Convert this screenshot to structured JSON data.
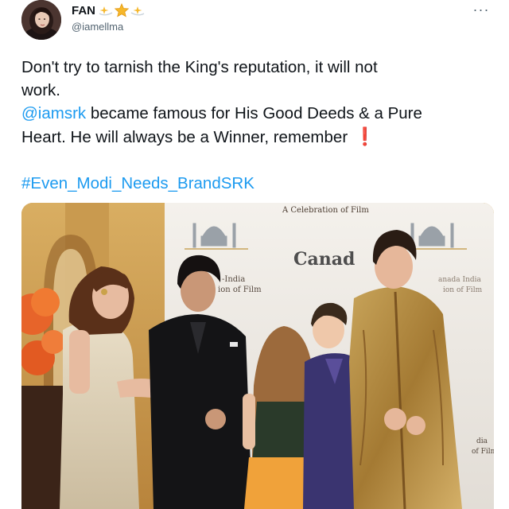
{
  "author": {
    "display_name": "FAN",
    "handle": "@iamellma",
    "name_emojis": [
      "sparkle-star-icon",
      "glowing-star-icon",
      "sparkle-star-icon"
    ]
  },
  "menu": {
    "more_label": "···"
  },
  "tweet": {
    "line1": "Don't try to tarnish the King's reputation, it will not",
    "line2": "work.",
    "mention": "@iamsrk",
    "line3_rest": " became famous for His Good Deeds  & a Pure",
    "line4": "Heart. He will always be a Winner, remember",
    "exclamation": "❗",
    "hashtag": "#Even_Modi_Needs_BrandSRK"
  },
  "media": {
    "backdrop_banner": "A Celebration of Film",
    "backdrop_center": "Canad",
    "backdrop_left_1": "-India",
    "backdrop_left_2": "ion of Film",
    "backdrop_right_1": "anada India",
    "backdrop_right_2": "ion of Film",
    "backdrop_right_3": "dia",
    "backdrop_right_4": "of Film"
  },
  "colors": {
    "link": "#1d9bf0",
    "text": "#0f1419",
    "secondary": "#536471",
    "exclaim": "#e0202a"
  }
}
